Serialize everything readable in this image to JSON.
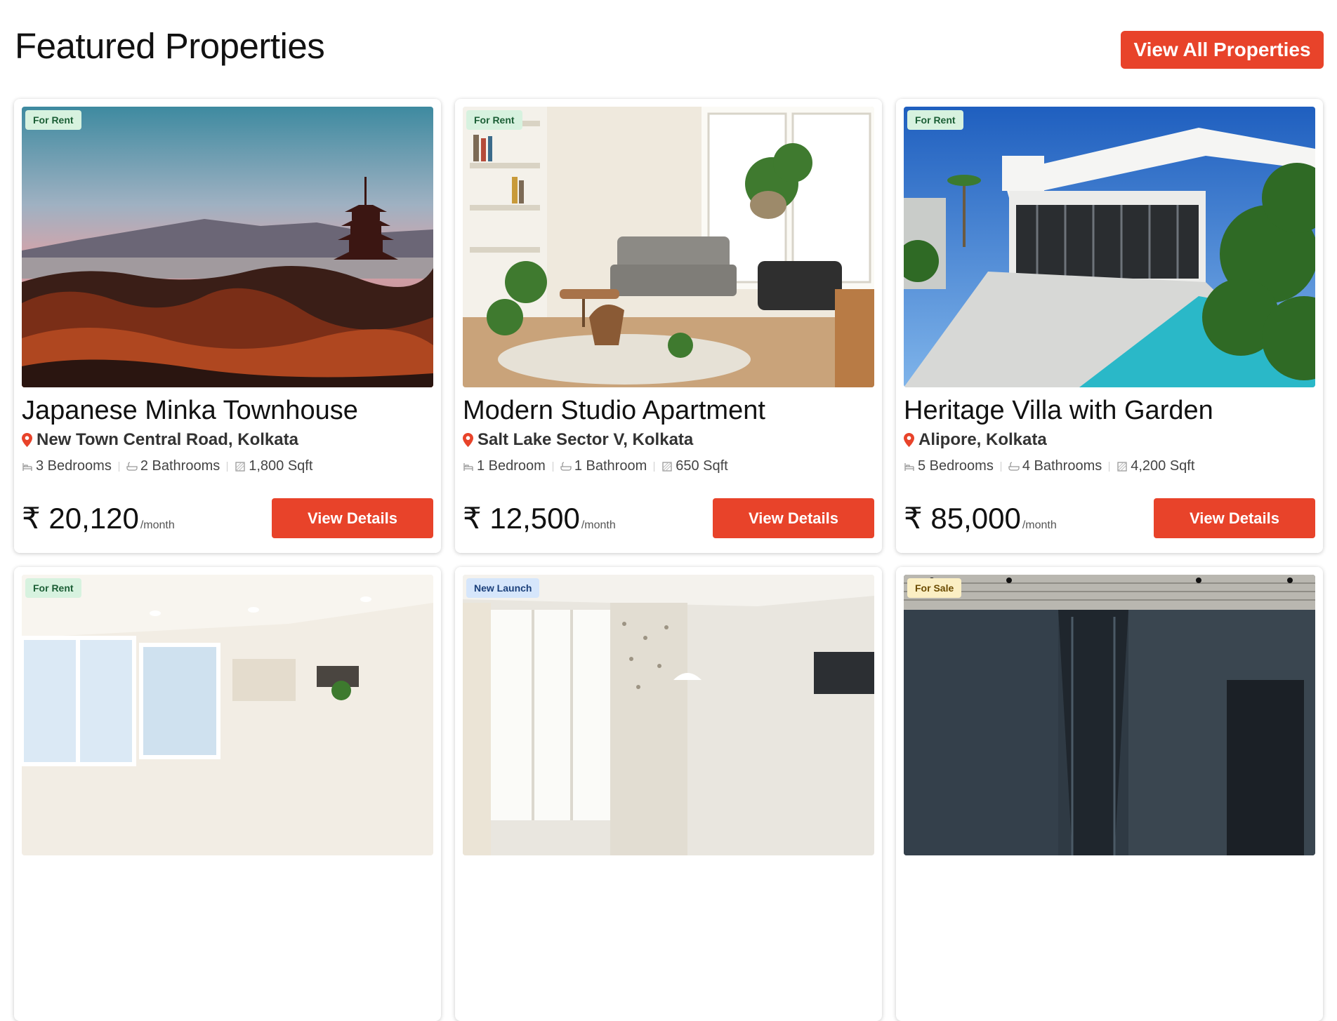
{
  "section": {
    "title": "Featured Properties",
    "view_all_label": "View All Properties"
  },
  "properties": [
    {
      "badge": "For Rent",
      "title": "Japanese Minka Townhouse",
      "location": "New Town Central Road, Kolkata",
      "bedrooms": "3 Bedrooms",
      "bathrooms": "2 Bathrooms",
      "area": "1,800 Sqft",
      "price": "₹ 20,120",
      "price_unit": "/month",
      "button": "View Details"
    },
    {
      "badge": "For Rent",
      "title": "Modern Studio Apartment",
      "location": "Salt Lake Sector V, Kolkata",
      "bedrooms": "1 Bedroom",
      "bathrooms": "1 Bathroom",
      "area": "650 Sqft",
      "price": "₹ 12,500",
      "price_unit": "/month",
      "button": "View Details"
    },
    {
      "badge": "For Rent",
      "title": "Heritage Villa with Garden",
      "location": "Alipore, Kolkata",
      "bedrooms": "5 Bedrooms",
      "bathrooms": "4 Bathrooms",
      "area": "4,200 Sqft",
      "price": "₹ 85,000",
      "price_unit": "/month",
      "button": "View Details"
    },
    {
      "badge": "For Rent"
    },
    {
      "badge": "New Launch"
    },
    {
      "badge": "For Sale"
    }
  ],
  "colors": {
    "accent": "#e8432a",
    "badge_rent_bg": "#d7f2df",
    "badge_launch_bg": "#d6e6fb",
    "badge_sale_bg": "#fbefc4"
  },
  "icons": {
    "location": "map-pin-icon",
    "bed": "bed-icon",
    "bath": "bathtub-icon",
    "area": "area-icon"
  }
}
